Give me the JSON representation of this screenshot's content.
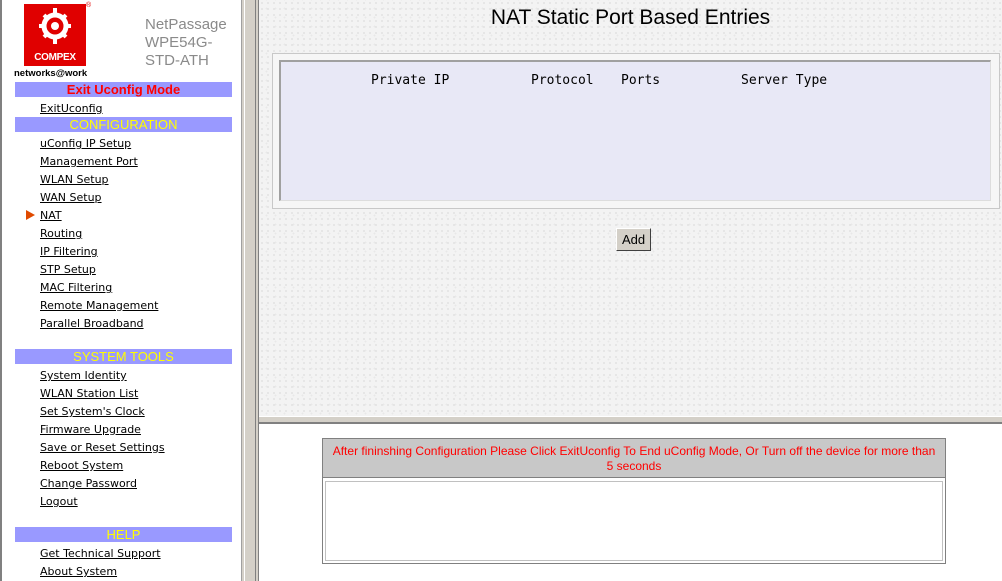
{
  "brand": {
    "logo_text": "COMPEX",
    "registered_mark": "®",
    "product_lines": [
      "NetPassage",
      "WPE54G-",
      "STD-ATH"
    ],
    "tagline": "networks@work"
  },
  "sidebar": {
    "exit_mode_label": "Exit Uconfig Mode",
    "exit_link": "ExitUconfig",
    "configuration": {
      "heading": "CONFIGURATION",
      "items": [
        "uConfig IP Setup",
        "Management Port",
        "WLAN Setup",
        "WAN Setup",
        "NAT",
        "Routing",
        "IP Filtering",
        "STP Setup",
        "MAC Filtering",
        "Remote Management",
        "Parallel Broadband"
      ],
      "active_item": "NAT"
    },
    "system_tools": {
      "heading": "SYSTEM TOOLS",
      "items": [
        "System Identity",
        "WLAN Station List",
        "Set System's Clock",
        "Firmware Upgrade",
        "Save or Reset Settings",
        "Reboot System",
        "Change Password",
        "Logout"
      ]
    },
    "help": {
      "heading": "HELP",
      "items": [
        "Get Technical Support",
        "About System"
      ]
    }
  },
  "main": {
    "title": "NAT Static Port Based Entries",
    "columns": [
      "Private IP",
      "Protocol",
      "Ports",
      "Server Type"
    ],
    "rows": [],
    "add_label": "Add"
  },
  "notice": {
    "message": "After fininshing Configuration Please Click ExitUconfig To End uConfig Mode, Or Turn off the device for more than 5 seconds"
  },
  "colors": {
    "section_bar": "#9999ff",
    "exit_text": "#ff0000",
    "section_text": "#ffff00",
    "logo_red": "#e00000",
    "active_arrow": "#e04a00",
    "table_bg": "#e8e8f6",
    "notice_text": "#ff0000"
  }
}
